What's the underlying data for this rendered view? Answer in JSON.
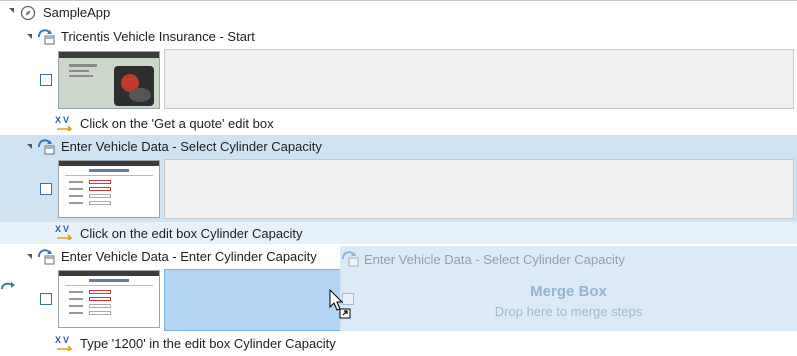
{
  "tree": {
    "root": {
      "label": "SampleApp"
    },
    "steps": [
      {
        "title": "Tricentis Vehicle Insurance - Start",
        "action": "Click on the 'Get a quote' edit box"
      },
      {
        "title": "Enter Vehicle Data - Select Cylinder Capacity",
        "action": "Click on the edit box Cylinder Capacity"
      },
      {
        "title": "Enter Vehicle Data - Enter Cylinder Capacity",
        "action": "Type '1200' in the edit box Cylinder Capacity"
      }
    ]
  },
  "drag_ghost": {
    "title": "Enter Vehicle Data - Select Cylinder Capacity"
  },
  "merge_box": {
    "title": "Merge Box",
    "hint": "Drop here to merge steps"
  },
  "colors": {
    "selected_row": "#cfe3f3",
    "merge_box": "#dbe9f8",
    "drop_target": "#b3d4f4"
  }
}
